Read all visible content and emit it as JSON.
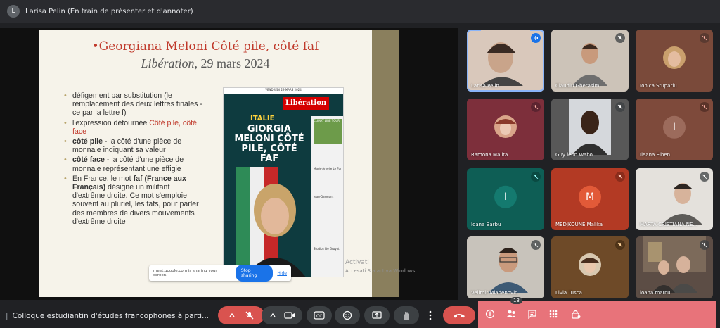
{
  "topbar": {
    "avatar_letter": "L",
    "presenter_text": "Larisa Pelin (En train de présenter et d'annoter)"
  },
  "slide": {
    "title_bullet": "•",
    "title": "Georgiana Meloni Côté pile, côté faf",
    "subtitle_italic": "Libération",
    "subtitle_rest": ", 29 mars 2024",
    "bullets": [
      {
        "text": "défigement par substitution (le remplacement des deux lettres finales -ce par la lettre f)"
      },
      {
        "before": "l'expression détournée ",
        "red": "Côté pile, côté face"
      },
      {
        "bold": "côté pile",
        "after": "  - la côté d'une pièce de monnaie indiquant sa valeur"
      },
      {
        "bold": "côté face",
        "after": "  - la côté d'une pièce de monnaie représentant une effigie"
      },
      {
        "before": "En France, le mot ",
        "bold": "faf (France aux Français)",
        "after": " désigne un militant d'extrême droite. Ce mot s'emploie souvent au pluriel, les fafs, pour parler des membres de divers mouvements d'extrême droite"
      }
    ],
    "cover": {
      "date": "VENDREDI 29 MARS 2024",
      "logo": "Libération",
      "kicker": "ITALIE",
      "headline": "GIORGIA MELONI CÔTÉ PILE, CÔTÉ FAF",
      "side_items": [
        "CLIMAT LIBE TOUR",
        "Marie-Amélie Le Fur",
        "Jean-Dasmont",
        "Studioz De Gruyot"
      ]
    }
  },
  "share_bar": {
    "message": "meet.google.com is sharing your screen.",
    "stop_label": "Stop sharing",
    "hide_label": "Hide"
  },
  "activate": {
    "line1": "Activati",
    "line2": "Accesati S              a activa Windows."
  },
  "participants": [
    {
      "name": "Larisa Pelin",
      "mic": "speaking"
    },
    {
      "name": "Claudiu Gherasim",
      "mic": "muted"
    },
    {
      "name": "Ionica Stupariu",
      "mic": "muted"
    },
    {
      "name": "Ramona Malita",
      "mic": "muted"
    },
    {
      "name": "Guy leon Wabo",
      "mic": "muted"
    },
    {
      "name": "Ileana Elben",
      "mic": "muted",
      "initial": "I"
    },
    {
      "name": "Ioana Barbu",
      "mic": "muted",
      "initial": "I"
    },
    {
      "name": "MEDJKOUNE Malika",
      "mic": "muted",
      "initial": "M"
    },
    {
      "name": "MARTA-CRISTIANA NE...",
      "mic": "muted"
    },
    {
      "name": "Velimir Mladenovic",
      "mic": "muted"
    },
    {
      "name": "Livia Tusca",
      "mic": "muted"
    },
    {
      "name": "ioana marcu",
      "mic": "muted"
    }
  ],
  "bottombar": {
    "separator": "|",
    "meeting_title": "Colloque estudiantin d'études francophones à parti..."
  },
  "participant_count": "13",
  "colors": {
    "accent": "#8ab4f8",
    "end_call": "#d9534f",
    "panel": "#e8737a",
    "title_red": "#c0392b"
  }
}
